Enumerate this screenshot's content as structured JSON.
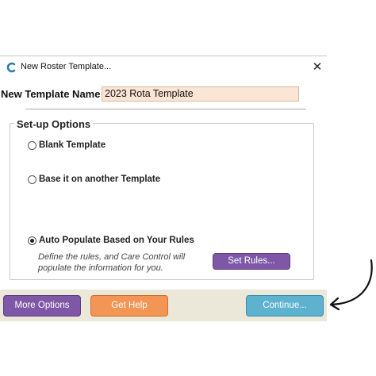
{
  "window": {
    "title": "New Roster Template...",
    "close_glyph": "✕"
  },
  "form": {
    "name_label": "New Template Name",
    "name_value": "2023 Rota Template"
  },
  "setup": {
    "legend": "Set-up Options",
    "options": [
      {
        "label": "Blank Template",
        "checked": false
      },
      {
        "label": "Base it on another Template",
        "checked": false
      },
      {
        "label": "Auto Populate Based on Your Rules",
        "checked": true
      }
    ],
    "description": "Define the rules, and Care Control will populate the information for you.",
    "set_rules_label": "Set Rules..."
  },
  "footer": {
    "more_options_label": "More Options",
    "get_help_label": "Get Help",
    "continue_label": "Continue..."
  },
  "icons": {
    "app": "care-control-logo-icon",
    "close": "close-icon",
    "annotation": "curved-arrow-icon"
  },
  "colors": {
    "purple": "#7e58a6",
    "orange": "#f39554",
    "blue": "#5cb2cf",
    "input_bg": "#fbe6d6",
    "footer_bg": "#ebe7d9",
    "logo_blue": "#2a7fa8"
  }
}
